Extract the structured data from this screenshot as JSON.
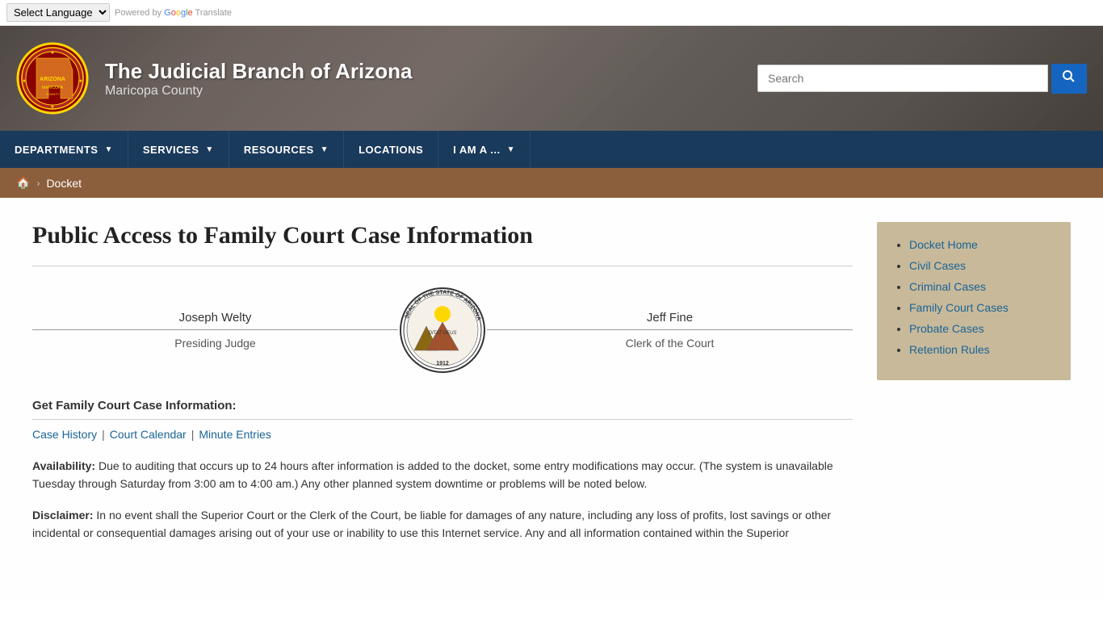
{
  "top_bar": {
    "language_select_label": "Select Language",
    "powered_by": "Powered by",
    "google": "Google",
    "translate": "Translate"
  },
  "header": {
    "title": "The Judicial Branch of Arizona",
    "subtitle": "Maricopa County",
    "search_placeholder": "Search"
  },
  "nav": {
    "items": [
      {
        "id": "departments",
        "label": "DEPARTMENTS",
        "has_arrow": true
      },
      {
        "id": "services",
        "label": "SERVICES",
        "has_arrow": true
      },
      {
        "id": "resources",
        "label": "RESOURCES",
        "has_arrow": true
      },
      {
        "id": "locations",
        "label": "LOCATIONS",
        "has_arrow": false
      },
      {
        "id": "i-am-a",
        "label": "I AM A ...",
        "has_arrow": true
      }
    ]
  },
  "breadcrumb": {
    "home_label": "🏠",
    "separator": "›",
    "current": "Docket"
  },
  "page": {
    "title": "Public Access to Family Court Case Information",
    "judge_name": "Joseph Welty",
    "judge_title": "Presiding Judge",
    "clerk_name": "Jeff Fine",
    "clerk_title": "Clerk of the Court",
    "case_info_heading": "Get Family Court Case Information:",
    "case_links": [
      {
        "label": "Case History",
        "href": "#"
      },
      {
        "label": "Court Calendar",
        "href": "#"
      },
      {
        "label": "Minute Entries",
        "href": "#"
      }
    ],
    "availability_bold": "Availability:",
    "availability_text": " Due to auditing that occurs up to 24 hours after information is added to the docket, some entry modifications may occur. (The system is unavailable Tuesday through Saturday from 3:00 am to 4:00 am.) Any other planned system downtime or problems will be noted below.",
    "disclaimer_bold": "Disclaimer:",
    "disclaimer_text": " In no event shall the Superior Court or the Clerk of the Court, be liable for damages of any nature, including any loss of profits, lost savings or other incidental or consequential damages arising out of your use or inability to use this Internet service. Any and all information contained within the Superior"
  },
  "sidebar": {
    "links": [
      {
        "label": "Docket Home",
        "href": "#"
      },
      {
        "label": "Civil Cases",
        "href": "#"
      },
      {
        "label": "Criminal Cases",
        "href": "#"
      },
      {
        "label": "Family Court Cases",
        "href": "#"
      },
      {
        "label": "Probate Cases",
        "href": "#"
      },
      {
        "label": "Retention Rules",
        "href": "#"
      }
    ]
  }
}
